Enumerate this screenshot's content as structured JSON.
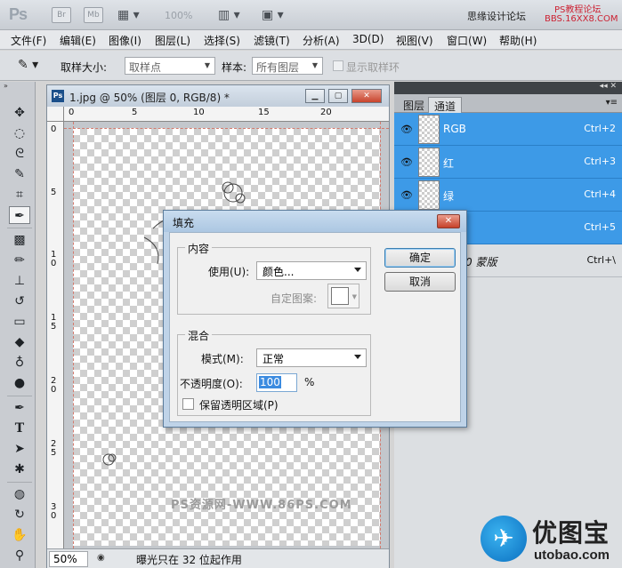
{
  "app": {
    "logo": "Ps",
    "btn_br": "Br",
    "btn_mb": "Mb",
    "zoom": "100%",
    "brand": "思缘设计论坛",
    "wm_line1": "PS教程论坛",
    "wm_line2": "BBS.16XX8.COM"
  },
  "menu": [
    "文件(F)",
    "编辑(E)",
    "图像(I)",
    "图层(L)",
    "选择(S)",
    "滤镜(T)",
    "分析(A)",
    "3D(D)",
    "视图(V)",
    "窗口(W)",
    "帮助(H)"
  ],
  "options": {
    "sample_size_label": "取样大小:",
    "sample_size_value": "取样点",
    "sample_label": "样本:",
    "sample_value": "所有图层",
    "show_ring_label": "显示取样环"
  },
  "document": {
    "title": "1.jpg @ 50% (图层 0, RGB/8) *",
    "ruler_h": [
      "0",
      "5",
      "10",
      "15",
      "20"
    ],
    "ruler_v": [
      "0",
      "5",
      "1 0",
      "1 5",
      "2 0",
      "2 5",
      "3 0"
    ],
    "canvas_watermark": "PS资源网-WWW.86PS.COM",
    "zoom": "50%",
    "status": "曝光只在 32 位起作用"
  },
  "panel": {
    "tabs": [
      "图层",
      "通道"
    ],
    "active_tab": "通道",
    "channels": [
      {
        "name": "RGB",
        "shortcut": "Ctrl+2",
        "selected": true
      },
      {
        "name": "红",
        "shortcut": "Ctrl+3",
        "selected": true
      },
      {
        "name": "绿",
        "shortcut": "Ctrl+4",
        "selected": true
      },
      {
        "name": "",
        "shortcut": "Ctrl+5",
        "selected": true
      },
      {
        "name": "0 蒙版",
        "shortcut": "Ctrl+\\",
        "selected": false
      }
    ]
  },
  "dialog": {
    "title": "填充",
    "contents_group": "内容",
    "use_label": "使用(U):",
    "use_value": "颜色...",
    "custom_pattern_label": "自定图案:",
    "blend_group": "混合",
    "mode_label": "模式(M):",
    "mode_value": "正常",
    "opacity_label": "不透明度(O):",
    "opacity_value": "100",
    "opacity_unit": "%",
    "preserve_label": "保留透明区域(P)",
    "ok_label": "确定",
    "cancel_label": "取消"
  },
  "logo": {
    "cn": "优图宝",
    "en": "utobao.com"
  },
  "colors": {
    "selection_blue": "#3d9ae7",
    "dialog_frame": "#bfd3e8"
  }
}
